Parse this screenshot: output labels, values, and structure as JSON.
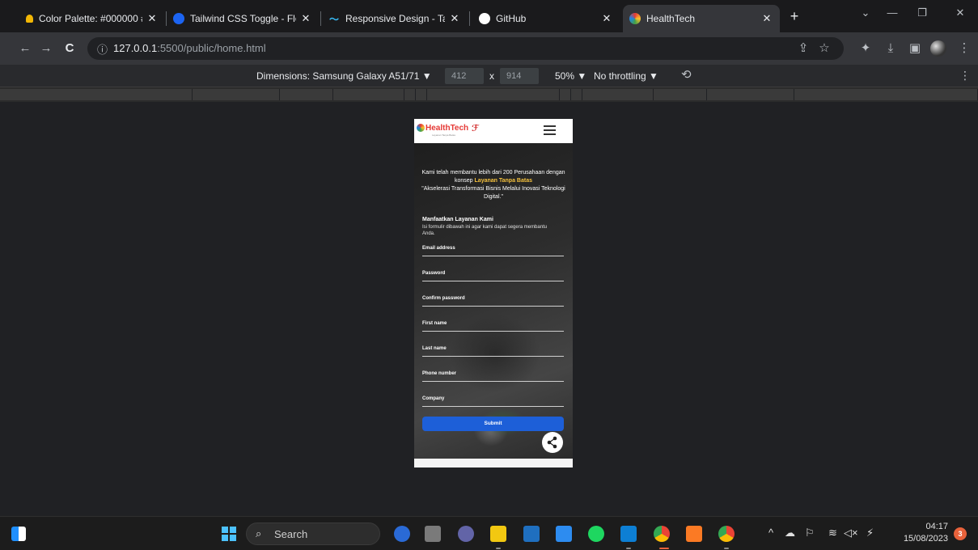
{
  "browser": {
    "tabs": [
      {
        "title": "Color Palette: #000000 #4",
        "favicon_color": "#f2b705",
        "icon": "palette-icon"
      },
      {
        "title": "Tailwind CSS Toggle - Flo",
        "favicon_color": "#1c64f2",
        "icon": "flowbite-icon"
      },
      {
        "title": "Responsive Design - Tailw",
        "favicon_color": "#38bdf8",
        "icon": "tailwind-icon"
      },
      {
        "title": "GitHub",
        "favicon_color": "#ffffff",
        "icon": "github-icon"
      },
      {
        "title": "HealthTech",
        "favicon_color": "#4caf50",
        "icon": "healthtech-favicon",
        "active": true
      }
    ],
    "url_host": "127.0.0.1",
    "url_rest": ":5500/public/home.html"
  },
  "devtools": {
    "dimensions_label": "Dimensions: Samsung Galaxy A51/71 ▼",
    "width": "412",
    "times": "x",
    "height": "914",
    "zoom": "50% ▼",
    "throttle": "No throttling ▼"
  },
  "site": {
    "logo_prefix": "Health",
    "logo_suffix": "Tech",
    "logo_tagline": "Layanan Tanpa Batas",
    "intro_line1": "Kami telah membantu lebih dari 200 Perusahaan dengan konsep",
    "intro_highlight": "Layanan Tanpa Batas",
    "intro_line2": "\"Akselerasi Transformasi Bisnis Melalui Inovasi Teknologi Digital.\"",
    "form_title": "Manfaatkan Layanan Kami",
    "form_desc": "Isi formulir dibawah ini agar kami dapat segera membantu Anda.",
    "fields": [
      "Email address",
      "Password",
      "Confirm password",
      "First name",
      "Last name",
      "Phone number",
      "Company"
    ],
    "submit_label": "Submit",
    "accent_color": "#1d5fd8",
    "highlight_color": "#f6c23e"
  },
  "taskbar": {
    "search_label": "Search",
    "time": "04:17",
    "date": "15/08/2023",
    "notification_count": "3"
  }
}
